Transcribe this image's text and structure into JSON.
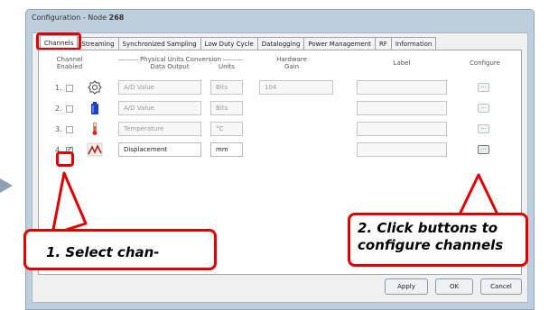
{
  "window": {
    "title_prefix": "Configuration - Node",
    "node_number": "268"
  },
  "tabs": [
    {
      "label": "Channels",
      "active": true
    },
    {
      "label": "Streaming",
      "active": false
    },
    {
      "label": "Synchronized Sampling",
      "active": false
    },
    {
      "label": "Low Duty Cycle",
      "active": false
    },
    {
      "label": "Datalogging",
      "active": false
    },
    {
      "label": "Power Management",
      "active": false
    },
    {
      "label": "RF",
      "active": false
    },
    {
      "label": "Information",
      "active": false
    }
  ],
  "headers": {
    "channel_enabled": [
      "Channel",
      "Enabled"
    ],
    "physical_units": "Physical Units Conversion",
    "data_output": "Data Output",
    "units": "Units",
    "hardware_gain": [
      "Hardware",
      "Gain"
    ],
    "label": "Label",
    "configure": "Configure"
  },
  "channels": [
    {
      "num": "1.",
      "enabled": false,
      "icon": "accelerometer-icon",
      "data_output": "A/D Value",
      "units": "Bits",
      "gain": "104",
      "label": "",
      "configure": "...",
      "active": false
    },
    {
      "num": "2.",
      "enabled": false,
      "icon": "battery-icon",
      "data_output": "A/D Value",
      "units": "Bits",
      "gain": "",
      "label": "",
      "configure": "...",
      "active": false
    },
    {
      "num": "3.",
      "enabled": false,
      "icon": "thermometer-icon",
      "data_output": "Temperature",
      "units": "°C",
      "gain": "",
      "label": "",
      "configure": "...",
      "active": false
    },
    {
      "num": "4.",
      "enabled": true,
      "icon": "displacement-sensor-icon",
      "data_output": "Displacement",
      "units": "mm",
      "gain": "",
      "label": "",
      "configure": "...",
      "active": true
    }
  ],
  "callouts": {
    "step1": "1.  Select chan-",
    "step2": "2.  Click buttons to configure channels"
  },
  "buttons": {
    "apply": "Apply",
    "ok": "OK",
    "cancel": "Cancel"
  },
  "colors": {
    "highlight": "#e00000",
    "window_frame": "#bfcedd"
  }
}
